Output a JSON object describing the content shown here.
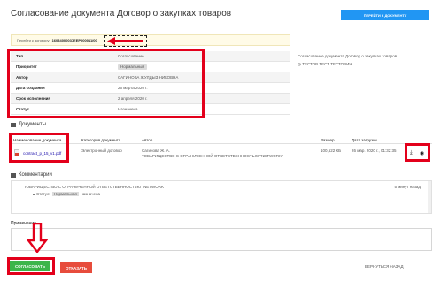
{
  "header": {
    "title": "Согласование документа Договор о закупках товаров",
    "goto_button": "ПЕРЕЙТИ К ДОКУМЕНТУ"
  },
  "contract_bar": {
    "label": "Перейти к договору:",
    "number": "16034000037ЕЕР000011/00"
  },
  "details": [
    {
      "key": "Тип",
      "value": "Согласование"
    },
    {
      "key": "Приоритет",
      "value": "Нормальный"
    },
    {
      "key": "Автор",
      "value": "САГИНОВА ЖУЛДЫЗ НИКОВНА"
    },
    {
      "key": "Дата создания",
      "value": "26 марта 2020 г."
    },
    {
      "key": "Срок исполнения",
      "value": "2 апреля 2020 г."
    },
    {
      "key": "Статус",
      "value": "Назначена"
    }
  ],
  "side": {
    "subject": "Согласование документа Договор о закупках товаров",
    "assignee": "ТЕСТОВ ТЕСТ ТЕСТОВИЧ"
  },
  "documents": {
    "section_title": "Документы",
    "columns": {
      "name": "Наименование документа",
      "category": "Категория документа",
      "author": "Автор",
      "size": "Размер",
      "uploaded": "Дата загрузки"
    },
    "rows": [
      {
        "name": "contract_p_15_v1.pdf",
        "category": "Электронный договор",
        "author_name": "Сагинова Ж. А.",
        "author_org": "ТОВАРИЩЕСТВО С ОГРАНИЧЕННОЙ ОТВЕТСТВЕННОСТЬЮ \"NETWORK\"",
        "size": "100,522 КБ",
        "uploaded": "26 мар. 2020 г., 01:32:35"
      }
    ]
  },
  "comments": {
    "section_title": "Комментарии",
    "org": "ТОВАРИЩЕСТВО С ОГРАНИЧЕННОЙ ОТВЕТСТВЕННОСТЬЮ \"NETWORK\"",
    "ago": "5 минут назад",
    "status_label": "Статус",
    "status_old": "Нормальная",
    "status_new": "назначена"
  },
  "remark": {
    "label": "Примечание"
  },
  "actions": {
    "approve": "СОГЛАСОВАТЬ",
    "reject": "ОТКАЗАТЬ",
    "back": "ВЕРНУТЬСЯ НАЗАД"
  },
  "colors": {
    "primary": "#2196f3",
    "approve": "#3cb54a",
    "reject": "#e74c3c",
    "highlight": "#e3001b"
  }
}
